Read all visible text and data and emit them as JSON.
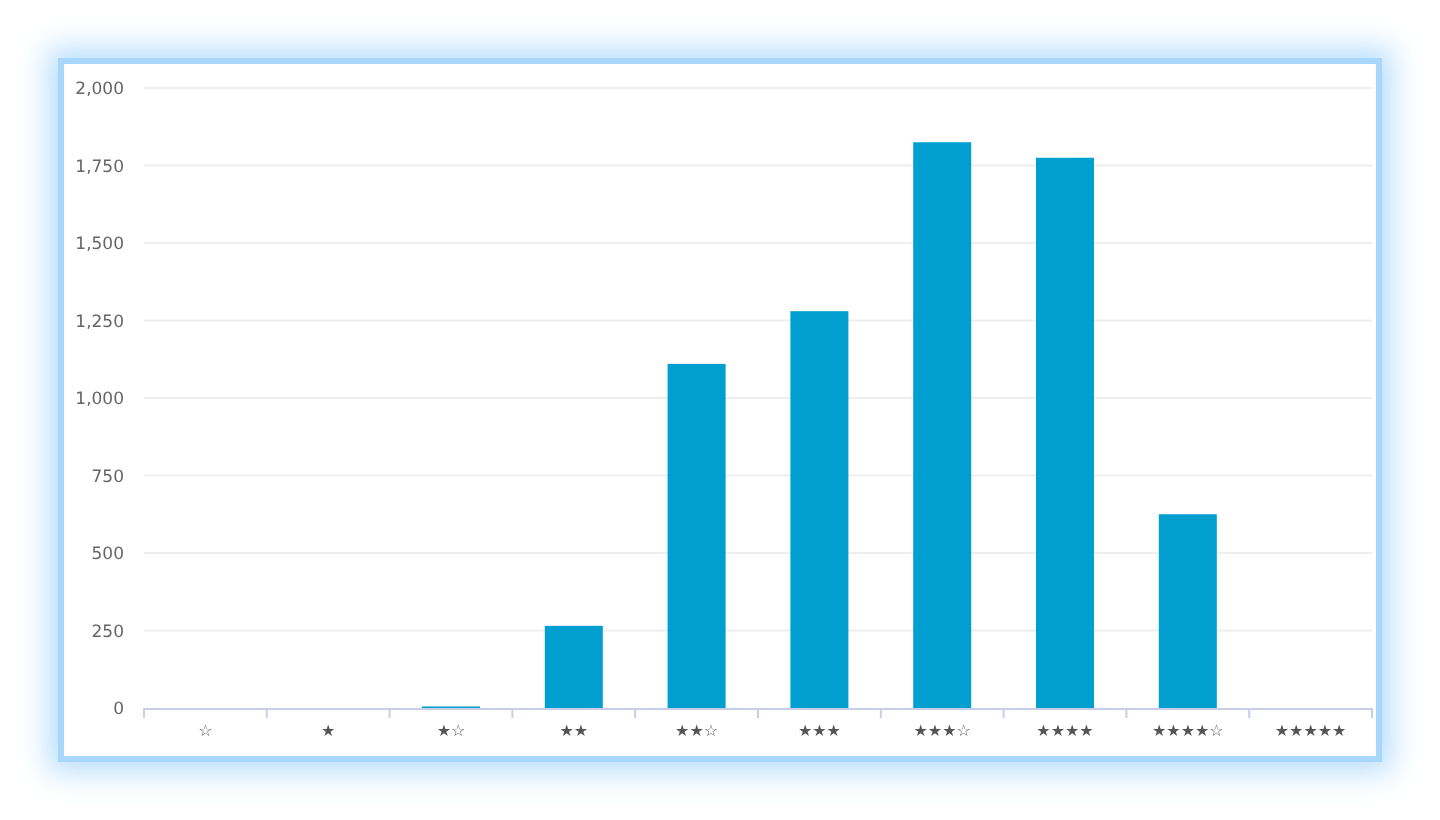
{
  "chart_data": {
    "type": "bar",
    "categories": [
      "☆",
      "★",
      "★☆",
      "★★",
      "★★☆",
      "★★★",
      "★★★☆",
      "★★★★",
      "★★★★☆",
      "★★★★★"
    ],
    "values": [
      0,
      0,
      5,
      265,
      1110,
      1280,
      1825,
      1775,
      625,
      0
    ],
    "grid": true,
    "ylim": [
      0,
      2000
    ],
    "yticks": [
      {
        "value": 0,
        "label": "0"
      },
      {
        "value": 250,
        "label": "250"
      },
      {
        "value": 500,
        "label": "500"
      },
      {
        "value": 750,
        "label": "750"
      },
      {
        "value": 1000,
        "label": "1,000"
      },
      {
        "value": 1250,
        "label": "1,250"
      },
      {
        "value": 1500,
        "label": "1,500"
      },
      {
        "value": 1750,
        "label": "1,750"
      },
      {
        "value": 2000,
        "label": "2,000"
      }
    ]
  }
}
